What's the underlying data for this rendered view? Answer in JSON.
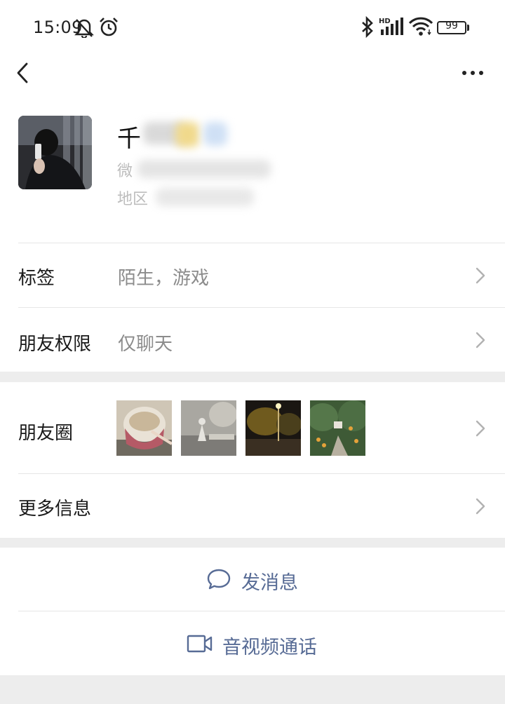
{
  "status_bar": {
    "time": "15:09",
    "battery": "99",
    "icons": [
      "bell-off-icon",
      "alarm-icon",
      "bluetooth-icon",
      "hd-signal-icon",
      "wifi-icon",
      "battery-icon"
    ]
  },
  "nav": {
    "back_icon": "chevron-left-icon",
    "more_icon": "more-dots-icon"
  },
  "profile": {
    "name_visible": "千",
    "wechat_id_prefix": "微",
    "region_prefix": "地区"
  },
  "rows": {
    "tags": {
      "label": "标签",
      "value": "陌生，游戏"
    },
    "permissions": {
      "label": "朋友权限",
      "value": "仅聊天"
    },
    "moments": {
      "label": "朋友圈"
    },
    "more_info": {
      "label": "更多信息"
    }
  },
  "actions": {
    "message": {
      "label": "发消息",
      "icon": "chat-bubble-icon"
    },
    "call": {
      "label": "音视频通话",
      "icon": "video-camera-icon"
    }
  },
  "colors": {
    "link_blue": "#576b95",
    "background": "#ededed",
    "divider": "#e6e6e6",
    "secondary_text": "#8c8c8c"
  }
}
